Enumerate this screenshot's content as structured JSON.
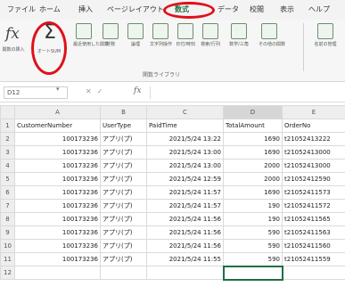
{
  "ribbon_tabs": [
    "ファイル",
    "ホーム",
    "挿入",
    "ページレイアウト",
    "数式",
    "データ",
    "校閲",
    "表示",
    "ヘルプ"
  ],
  "ribbon_buttons": [
    "関数の挿入",
    "オートSUM",
    "最近使用した関数",
    "財務",
    "論理",
    "文字列操作",
    "日付/時刻",
    "検索/行列",
    "数学/三角",
    "その他の関数",
    "名前の管理"
  ],
  "group_label": "関数ライブラリ",
  "name_box": "D12",
  "column_headers": [
    "A",
    "B",
    "C",
    "D",
    "E"
  ],
  "row_numbers": [
    "1",
    "2",
    "3",
    "4",
    "5",
    "6",
    "7",
    "8",
    "9",
    "10",
    "11",
    "12"
  ],
  "rows": [
    [
      "CustomerNumber",
      "UserType",
      "PaidTime",
      "TotalAmount",
      "OrderNo"
    ],
    [
      "100173236",
      "アプリ(プ)",
      "2021/5/24 13:22",
      "1690",
      "t21052413222"
    ],
    [
      "100173236",
      "アプリ(プ)",
      "2021/5/24 13:00",
      "1690",
      "t21052413000"
    ],
    [
      "100173236",
      "アプリ(プ)",
      "2021/5/24 13:00",
      "2000",
      "t21052413000"
    ],
    [
      "100173236",
      "アプリ(プ)",
      "2021/5/24 12:59",
      "2000",
      "t21052412590"
    ],
    [
      "100173236",
      "アプリ(プ)",
      "2021/5/24 11:57",
      "1690",
      "t21052411573"
    ],
    [
      "100173236",
      "アプリ(プ)",
      "2021/5/24 11:57",
      "190",
      "t21052411572"
    ],
    [
      "100173236",
      "アプリ(プ)",
      "2021/5/24 11:56",
      "190",
      "t21052411565"
    ],
    [
      "100173236",
      "アプリ(プ)",
      "2021/5/24 11:56",
      "590",
      "t21052411563"
    ],
    [
      "100173236",
      "アプリ(プ)",
      "2021/5/24 11:56",
      "590",
      "t21052411560"
    ],
    [
      "100173236",
      "アプリ(プ)",
      "2021/5/24 11:55",
      "590",
      "t21052411559"
    ],
    [
      "",
      "",
      "",
      "",
      ""
    ]
  ],
  "accent_color": "#1d6f42",
  "highlight_color": "#e0101a",
  "icons": [
    "fx-icon",
    "sigma-icon",
    "function-category-icon",
    "name-manager-icon",
    "dropdown-arrow-icon",
    "cancel-icon",
    "enter-icon"
  ]
}
